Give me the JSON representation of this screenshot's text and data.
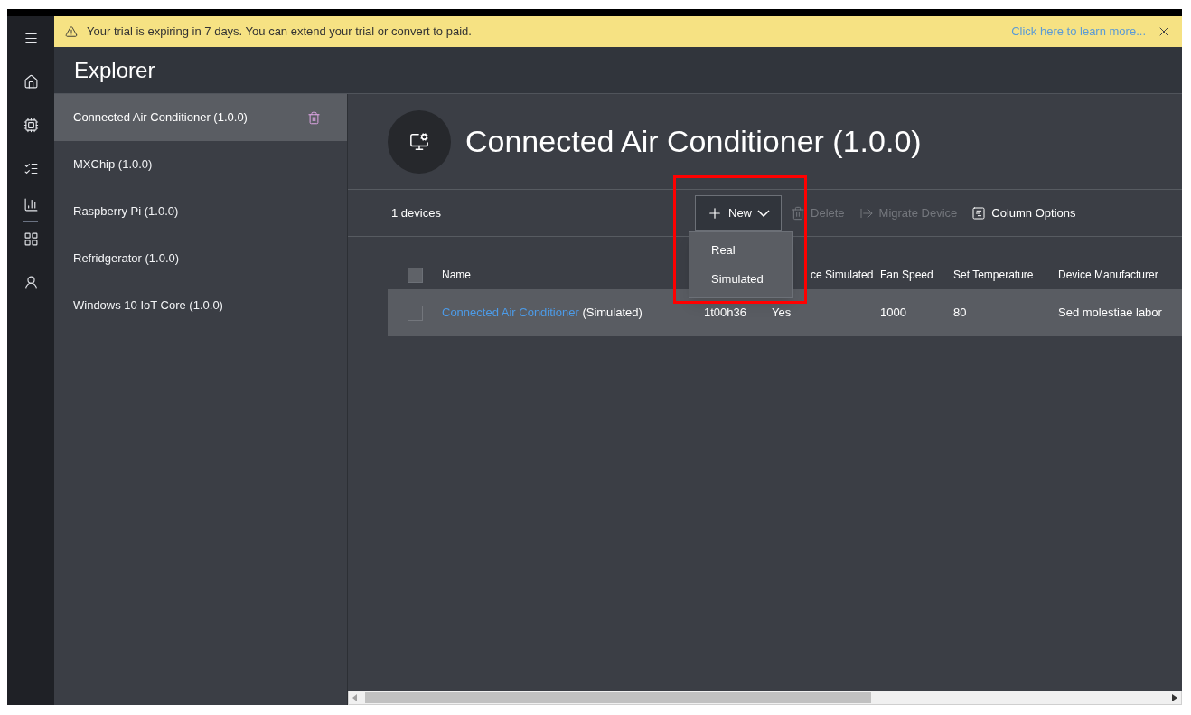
{
  "banner": {
    "message": "Your trial is expiring in 7 days. You can extend your trial or convert to paid.",
    "link": "Click here to learn more..."
  },
  "header": {
    "title": "Explorer"
  },
  "sidebar": {
    "items": [
      {
        "label": "Connected Air Conditioner (1.0.0)",
        "selected": true
      },
      {
        "label": "MXChip (1.0.0)",
        "selected": false
      },
      {
        "label": "Raspberry Pi (1.0.0)",
        "selected": false
      },
      {
        "label": "Refridgerator (1.0.0)",
        "selected": false
      },
      {
        "label": "Windows 10 IoT Core (1.0.0)",
        "selected": false
      }
    ]
  },
  "template": {
    "title": "Connected Air Conditioner (1.0.0)"
  },
  "toolbar": {
    "count": "1 devices",
    "new_button": {
      "label": "New",
      "expanded": true,
      "menu": [
        "Real",
        "Simulated"
      ]
    },
    "actions": [
      {
        "kind": "delete",
        "label": "Delete",
        "disabled": true
      },
      {
        "kind": "migrate",
        "label": "Migrate Device",
        "disabled": true
      },
      {
        "kind": "columns",
        "label": "Column Options",
        "disabled": false
      }
    ]
  },
  "table": {
    "header_checked": false,
    "columns": [
      "Name",
      "",
      "ce Simulated",
      "Fan Speed",
      "Set Temperature",
      "Device Manufacturer"
    ],
    "rows": [
      {
        "checked": false,
        "cells": [
          {
            "link": "Connected Air Conditioner",
            "text": "(Simulated)"
          },
          {
            "text": "1t00h36"
          },
          {
            "text": "Yes"
          },
          {
            "text": "1000"
          },
          {
            "text": "80"
          },
          {
            "text": "Sed molestiae labor"
          }
        ]
      }
    ]
  }
}
